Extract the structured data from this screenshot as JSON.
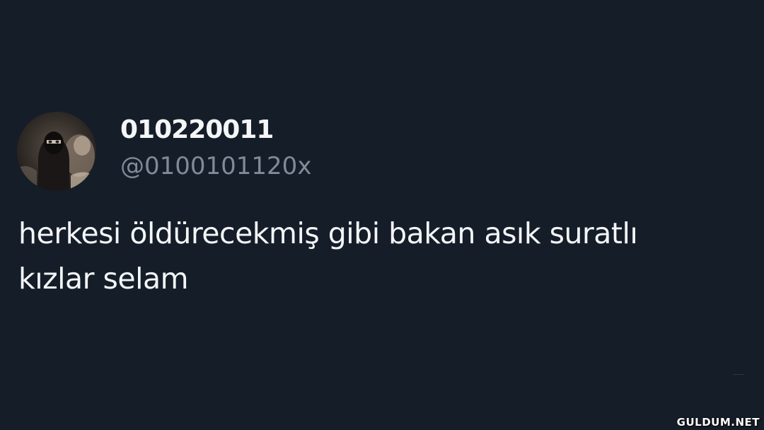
{
  "tweet": {
    "display_name": "010220011",
    "handle": "@0100101120x",
    "text": "herkesi öldürecekmiş gibi bakan asık suratlı\nkızlar selam",
    "avatar_icon": "masked-person-avatar"
  },
  "watermark": {
    "text": "GULDUM.NET"
  },
  "colors": {
    "background": "#151d28",
    "primary_text": "#f3f5f7",
    "secondary_text": "#7f8b97"
  }
}
